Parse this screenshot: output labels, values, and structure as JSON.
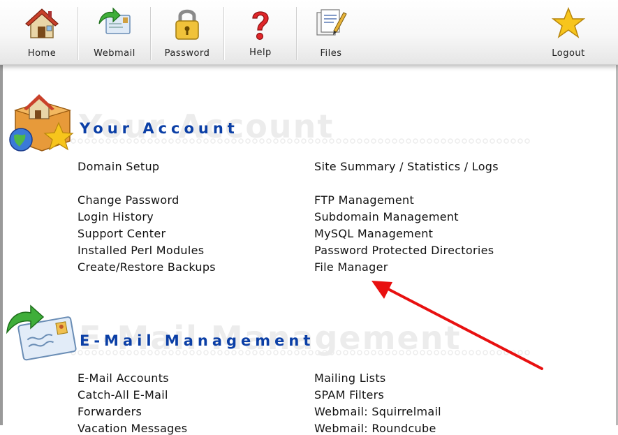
{
  "toolbar": {
    "home": "Home",
    "webmail": "Webmail",
    "password": "Password",
    "help": "Help",
    "files": "Files",
    "logout": "Logout"
  },
  "account": {
    "title": "Your Account",
    "watermark": "Your Account",
    "left": [
      "Domain Setup",
      "Change Password",
      "Login History",
      "Support Center",
      "Installed Perl Modules",
      "Create/Restore Backups"
    ],
    "right": [
      "Site Summary / Statistics / Logs",
      "FTP Management",
      "Subdomain Management",
      "MySQL Management",
      "Password Protected Directories",
      "File Manager"
    ]
  },
  "email": {
    "title": "E-Mail Management",
    "watermark": "E-Mail Management",
    "left": [
      "E-Mail Accounts",
      "Catch-All E-Mail",
      "Forwarders",
      "Vacation Messages"
    ],
    "right": [
      "Mailing Lists",
      "SPAM Filters",
      "Webmail: Squirrelmail",
      "Webmail: Roundcube"
    ]
  },
  "colors": {
    "title": "#0b3fa6",
    "arrow": "#e81010"
  }
}
